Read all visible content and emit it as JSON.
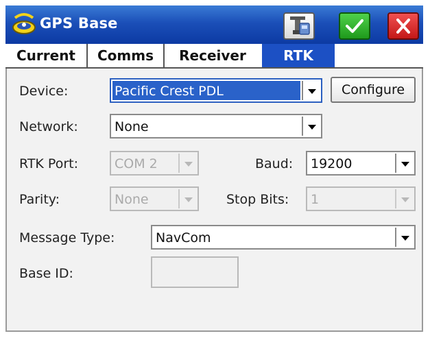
{
  "window": {
    "title": "GPS Base",
    "icons": {
      "app": "gps-satellite-icon",
      "device": "receiver-device-icon",
      "ok": "checkmark-icon",
      "close": "close-icon"
    },
    "colors": {
      "titlebar": "#1b4fb8",
      "active_tab": "#1c50c4",
      "ok": "#1f9a1c",
      "close": "#c41818"
    }
  },
  "tabs": [
    {
      "label": "Current"
    },
    {
      "label": "Comms"
    },
    {
      "label": "Receiver"
    },
    {
      "label": "RTK",
      "active": true
    }
  ],
  "form": {
    "device": {
      "label": "Device:",
      "value": "Pacific Crest PDL",
      "button": "Configure"
    },
    "network": {
      "label": "Network:",
      "value": "None"
    },
    "rtk_port": {
      "label": "RTK Port:",
      "value": "COM 2"
    },
    "baud": {
      "label": "Baud:",
      "value": "19200"
    },
    "parity": {
      "label": "Parity:",
      "value": "None"
    },
    "stop_bits": {
      "label": "Stop Bits:",
      "value": "1"
    },
    "message_type": {
      "label": "Message Type:",
      "value": "NavCom"
    },
    "base_id": {
      "label": "Base ID:",
      "value": ""
    }
  }
}
